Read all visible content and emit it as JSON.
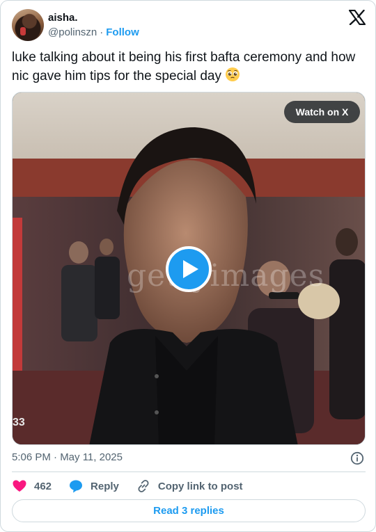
{
  "author": {
    "name": "aisha.",
    "handle": "@polinszn",
    "separator": "·",
    "follow_label": "Follow"
  },
  "tweet": {
    "text": "luke talking about it being his first bafta ceremony and how nic gave him tips for the special day",
    "emoji": "pleading-face",
    "timestamp": "5:06 PM · May 11, 2025"
  },
  "media": {
    "watch_label": "Watch on X",
    "watermark": "gettyimages",
    "frame_label": "33"
  },
  "actions": {
    "likes_count": "462",
    "reply_label": "Reply",
    "copy_label": "Copy link to post",
    "read_replies_label": "Read 3 replies"
  },
  "colors": {
    "accent": "#1d9bf0",
    "like": "#f91880",
    "secondary_text": "#536471",
    "border": "#cfd9de"
  }
}
